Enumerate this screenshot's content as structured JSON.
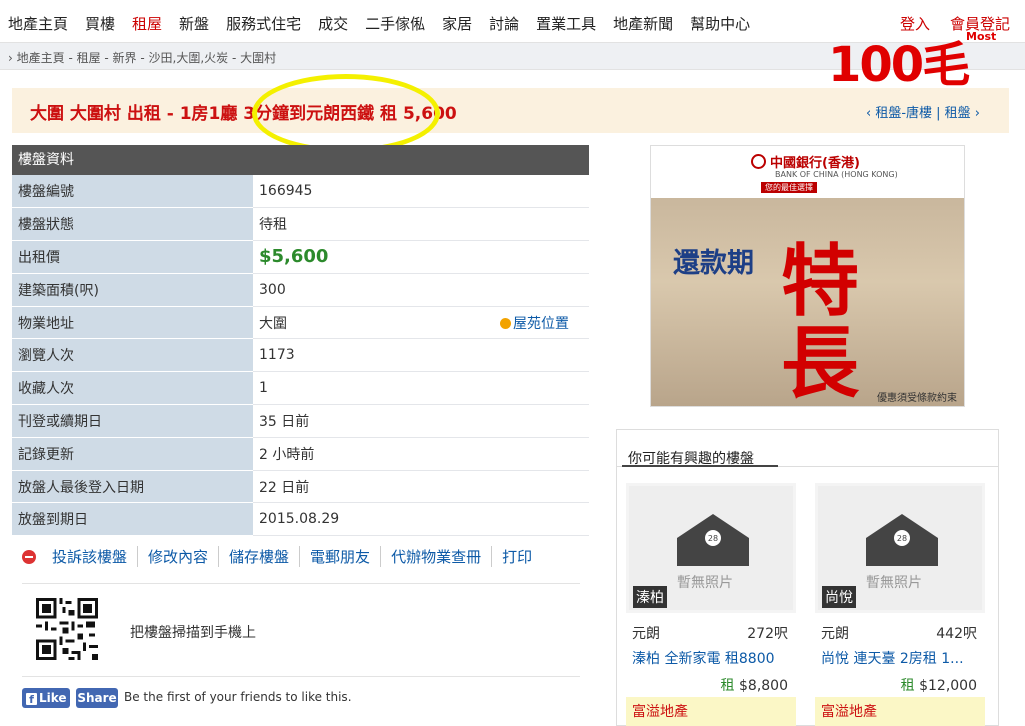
{
  "nav": {
    "items": [
      "地產主頁",
      "買樓",
      "租屋",
      "新盤",
      "服務式住宅",
      "成交",
      "二手傢俬",
      "家居",
      "討論",
      "置業工具",
      "地產新聞",
      "幫助中心"
    ],
    "active": "租屋",
    "login": "登入",
    "register": "會員登記"
  },
  "breadcrumb": "地產主頁 - 租屋 - 新界 - 沙田,大圍,火炭 - 大圍村",
  "logo": {
    "text": "100毛",
    "small": "Most"
  },
  "listing": {
    "title": "大圍 大圍村 出租 - 1房1廳 3分鐘到元朗西鐵 租 5,600",
    "right_links": "‹ 租盤-唐樓 | 租盤 ›"
  },
  "info": {
    "header": "樓盤資料",
    "rows": [
      {
        "k": "樓盤編號",
        "v": "166945"
      },
      {
        "k": "樓盤狀態",
        "v": "待租"
      },
      {
        "k": "出租價",
        "v": "$5,600"
      },
      {
        "k": "建築面積(呎)",
        "v": "300"
      },
      {
        "k": "物業地址",
        "v": "大圍"
      },
      {
        "k": "瀏覽人次",
        "v": "1173"
      },
      {
        "k": "收藏人次",
        "v": "1"
      },
      {
        "k": "刊登或續期日",
        "v": "35 日前"
      },
      {
        "k": "記錄更新",
        "v": "2 小時前"
      },
      {
        "k": "放盤人最後登入日期",
        "v": "22 日前"
      },
      {
        "k": "放盤到期日",
        "v": "2015.08.29"
      }
    ],
    "locate_label": "屋苑位置"
  },
  "actions": [
    "投訴該樓盤",
    "修改內容",
    "儲存樓盤",
    "電郵朋友",
    "代辦物業查冊",
    "打印"
  ],
  "qr_text": "把樓盤掃描到手機上",
  "facebook": {
    "like": "Like",
    "share": "Share",
    "text": "Be the first of your friends to like this."
  },
  "ad": {
    "bank": "中國銀行(香港)",
    "bank_en": "BANK OF CHINA (HONG KONG)",
    "sub": "您的最佳選擇",
    "slogan1": "還款期",
    "slogan2": "特長",
    "note": "優惠須受條款約束"
  },
  "suggest": {
    "title": "你可能有興趣的樓盤",
    "no_photo": "暫無照片",
    "cards": [
      {
        "tag": "溱柏",
        "area": "元朗",
        "size": "272呎",
        "name": "溱柏 全新家電 租8800",
        "rent_label": "租",
        "price": "$8,800",
        "agent": "富溢地產"
      },
      {
        "tag": "尚悅",
        "area": "元朗",
        "size": "442呎",
        "name": "尚悅 連天臺 2房租 1...",
        "rent_label": "租",
        "price": "$12,000",
        "agent": "富溢地產"
      }
    ]
  }
}
